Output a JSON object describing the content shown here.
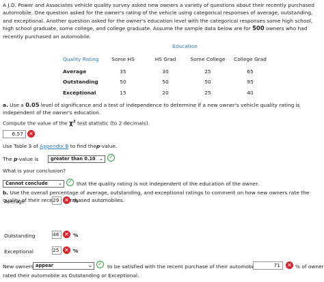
{
  "intro": "A J.D. Power and Associates vehicle quality survey asked new owners a variety of questions about their recently purchased automobile. One question asked for the owner's rating of the vehicle using categorical responses of average, outstanding, and exceptional. Another question asked for the owner's education level with the categorical responses some high school, high school graduate, some college, and college graduate. Assume the sample data below are for",
  "intro_count": "500",
  "intro_end": "owners who had recently purchased an automobile.",
  "table": {
    "education_header": "Education",
    "row_header": "Quality Rating",
    "columns": [
      "Some HS",
      "HS Grad",
      "Some College",
      "College Grad"
    ],
    "rows": [
      {
        "label": "Average",
        "values": [
          "35",
          "30",
          "25",
          "65"
        ]
      },
      {
        "label": "Outstanding",
        "values": [
          "50",
          "50",
          "50",
          "95"
        ]
      },
      {
        "label": "Exceptional",
        "values": [
          "15",
          "20",
          "25",
          "40"
        ]
      }
    ]
  },
  "part_a": {
    "prefix": "a.",
    "text_1": "Use a",
    "alpha": "0.05",
    "text_2": "level of significance and a test of independence to determine if a new owner's vehicle quality rating is independent of the owner's education.",
    "compute_text": "Compute the value of the",
    "chi": "χ",
    "chi_sup": "2",
    "compute_end": "test statistic (to 2 decimals).",
    "chi_value": "6.57",
    "table_text_1": "Use Table 3 of",
    "appendix_link": "Appendix B",
    "table_text_2": "to find the",
    "p_label": "p",
    "table_text_3": "-value.",
    "pvalue_text_1": "The",
    "pvalue_text_2": "-value is",
    "pvalue_select": "greater than 0.10",
    "conclusion_q": "What is your conclusion?",
    "conclusion_select": "Cannot conclude",
    "conclusion_text": "that the quality rating is not independent of the education of the owner."
  },
  "part_b": {
    "prefix": "b.",
    "text": "Use the overall percentage of average, outstanding, and exceptional ratings to comment on how new owners rate the quality of their recently purchased automobiles.",
    "ratings": [
      {
        "label": "Average",
        "value": "29",
        "unit": "%"
      },
      {
        "label": "Outstanding",
        "value": "46",
        "unit": "%"
      },
      {
        "label": "Exceptional",
        "value": "25",
        "unit": "%"
      }
    ],
    "new_owners_text": "New owners",
    "owners_select": "appear",
    "satisfied_text": "to be satisfied with the recent purchase of their automobile.",
    "percent_value": "71",
    "percent_text": "% of owners",
    "final_text": "rated their automobile as Outstanding or Exceptional."
  },
  "colors": {
    "accent": "#2a7ab8",
    "error": "#d7262f",
    "correct": "#2f9e44"
  }
}
